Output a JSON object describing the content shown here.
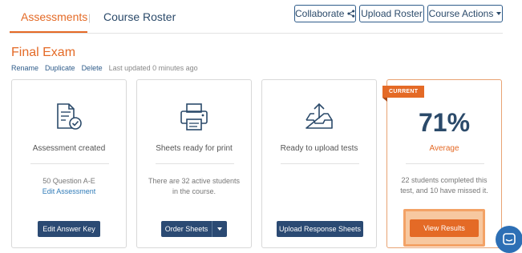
{
  "nav": {
    "tab_assessments": "Assessments",
    "separator": "|",
    "tab_roster": "Course Roster",
    "collaborate": "Collaborate",
    "upload_roster": "Upload Roster",
    "course_actions": "Course Actions"
  },
  "exam": {
    "title": "Final Exam",
    "rename": "Rename",
    "duplicate": "Duplicate",
    "delete": "Delete",
    "updated": "Last updated 0 minutes ago"
  },
  "cards": [
    {
      "label": "Assessment created",
      "desc_line": "50 Question A-E",
      "link": "Edit Assessment",
      "button": "Edit Answer Key",
      "icon": "document-check-icon"
    },
    {
      "label": "Sheets ready for print",
      "desc": "There are 32 active students in the course.",
      "button": "Order Sheets",
      "icon": "printer-icon"
    },
    {
      "label": "Ready to upload tests",
      "button": "Upload Response Sheets",
      "icon": "upload-tray-icon"
    },
    {
      "badge": "CURRENT",
      "percent": "71%",
      "average_label": "Average",
      "desc": "22 students completed this test, and 10 have missed it.",
      "button": "View Results"
    }
  ],
  "colors": {
    "accent": "#e46a26",
    "navy": "#2b4a73",
    "chat": "#2d6fb5"
  }
}
